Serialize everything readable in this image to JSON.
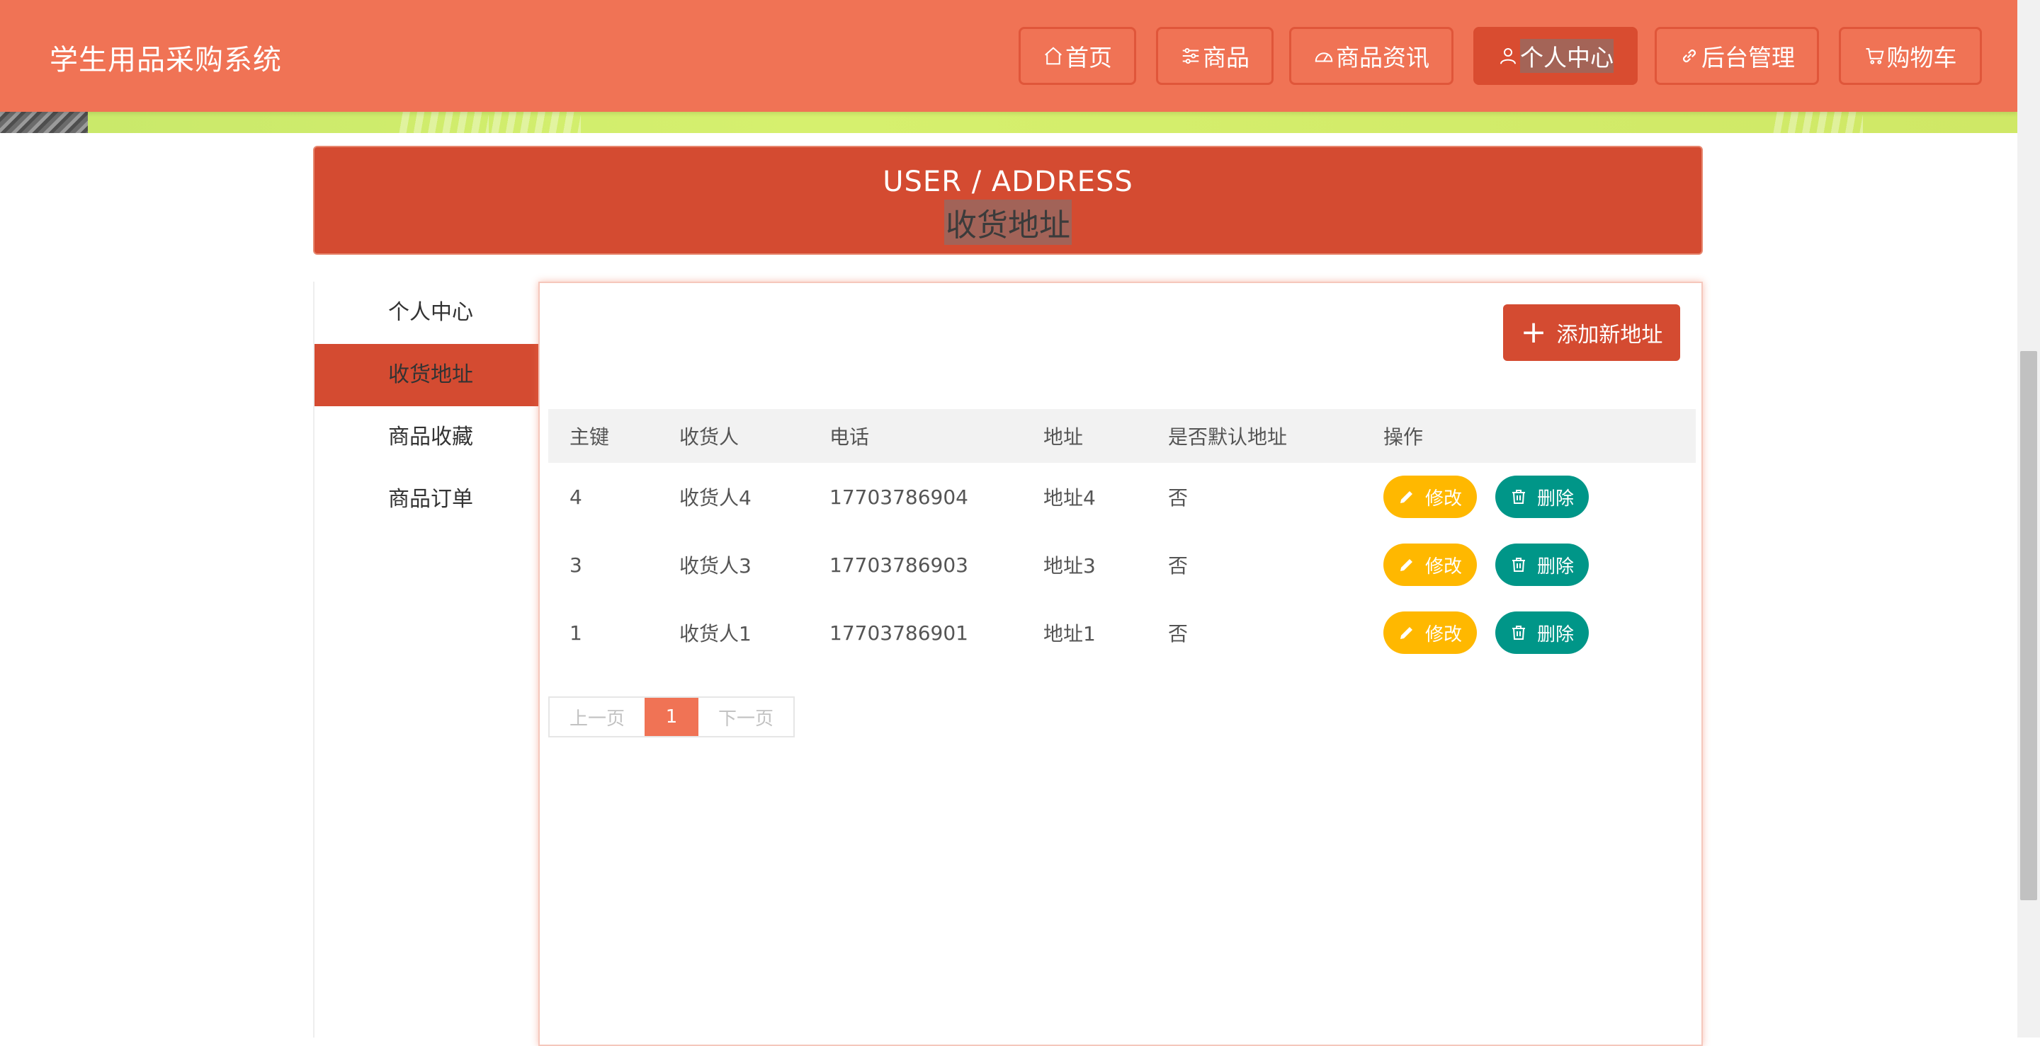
{
  "header": {
    "site_title": "学生用品采购系统",
    "nav": [
      {
        "label": "首页",
        "icon": "home-icon"
      },
      {
        "label": "商品",
        "icon": "sliders-icon"
      },
      {
        "label": "商品资讯",
        "icon": "gauge-icon"
      },
      {
        "label": "个人中心",
        "icon": "user-icon",
        "active": true
      },
      {
        "label": "后台管理",
        "icon": "link-icon"
      },
      {
        "label": "购物车",
        "icon": "cart-icon"
      }
    ]
  },
  "page_head": {
    "en": "USER / ADDRESS",
    "cn": "收货地址"
  },
  "sidebar": {
    "items": [
      {
        "label": "个人中心"
      },
      {
        "label": "收货地址",
        "active": true
      },
      {
        "label": "商品收藏"
      },
      {
        "label": "商品订单"
      }
    ]
  },
  "panel": {
    "add_label": "添加新地址",
    "columns": [
      "主键",
      "收货人",
      "电话",
      "地址",
      "是否默认地址",
      "操作"
    ],
    "rows": [
      {
        "id": "4",
        "name": "收货人4",
        "phone": "17703786904",
        "address": "地址4",
        "default": "否"
      },
      {
        "id": "3",
        "name": "收货人3",
        "phone": "17703786903",
        "address": "地址3",
        "default": "否"
      },
      {
        "id": "1",
        "name": "收货人1",
        "phone": "17703786901",
        "address": "地址1",
        "default": "否"
      }
    ],
    "edit_label": "修改",
    "delete_label": "删除",
    "pager": {
      "prev": "上一页",
      "current": "1",
      "next": "下一页"
    }
  },
  "colors": {
    "header_bg": "#f07355",
    "accent": "#d44b31",
    "edit": "#ffb800",
    "delete": "#009688"
  }
}
